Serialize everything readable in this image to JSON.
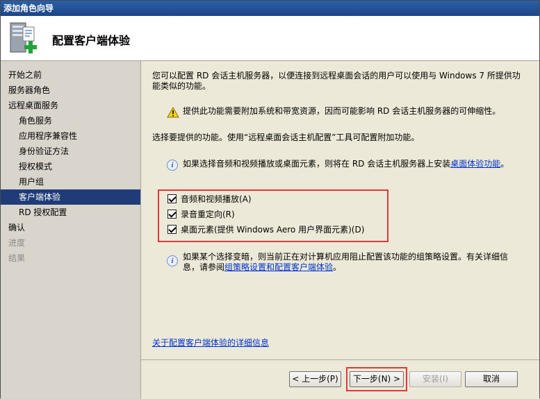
{
  "window": {
    "title": "添加角色向导"
  },
  "header": {
    "title": "配置客户端体验",
    "icon": "server-add-icon"
  },
  "sidebar": {
    "items": [
      {
        "label": "开始之前",
        "level": 0,
        "state": "normal"
      },
      {
        "label": "服务器角色",
        "level": 0,
        "state": "normal"
      },
      {
        "label": "远程桌面服务",
        "level": 0,
        "state": "normal"
      },
      {
        "label": "角色服务",
        "level": 1,
        "state": "normal"
      },
      {
        "label": "应用程序兼容性",
        "level": 1,
        "state": "normal"
      },
      {
        "label": "身份验证方法",
        "level": 1,
        "state": "normal"
      },
      {
        "label": "授权模式",
        "level": 1,
        "state": "normal"
      },
      {
        "label": "用户组",
        "level": 1,
        "state": "normal"
      },
      {
        "label": "客户端体验",
        "level": 1,
        "state": "selected"
      },
      {
        "label": "RD 授权配置",
        "level": 1,
        "state": "normal"
      },
      {
        "label": "确认",
        "level": 0,
        "state": "normal"
      },
      {
        "label": "进度",
        "level": 0,
        "state": "disabled"
      },
      {
        "label": "结果",
        "level": 0,
        "state": "disabled"
      }
    ]
  },
  "content": {
    "intro": "您可以配置 RD 会话主机服务器，以便连接到远程桌面会话的用户可以使用与 Windows 7 所提供功能类似的功能。",
    "warning": "提供此功能需要附加系统和带宽资源，因而可能影响 RD 会话主机服务器的可伸缩性。",
    "select_prompt": "选择要提供的功能。使用“远程桌面会话主机配置”工具可配置附加功能。",
    "info1_prefix": "如果选择音频和视频播放或桌面元素，则将在 RD 会话主机服务器上安装",
    "info1_link": "桌面体验功能",
    "info1_suffix": "。",
    "checkboxes": [
      {
        "label": "音频和视频播放(A)",
        "checked": true
      },
      {
        "label": "录音重定向(R)",
        "checked": true
      },
      {
        "label": "桌面元素(提供 Windows Aero 用户界面元素)(D)",
        "checked": true
      }
    ],
    "info2_line1": "如果某个选择变暗，则当前正在对计算机应用阻止配置该功能的组策略设置。有关详细信",
    "info2_line2_prefix": "息，请参阅",
    "info2_link": "组策略设置和配置客户端体验",
    "info2_suffix": "。",
    "more_info_link": "关于配置客户端体验的详细信息"
  },
  "footer": {
    "back_label": "< 上一步(P)",
    "next_label": "下一步(N) >",
    "install_label": "安装(I)",
    "cancel_label": "取消"
  },
  "colors": {
    "highlight": "#e03838",
    "selected": "#1f3c78",
    "link": "#0033cc"
  }
}
